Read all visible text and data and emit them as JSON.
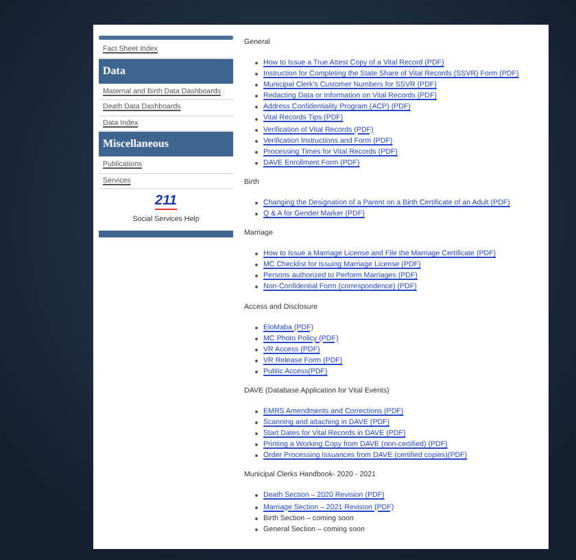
{
  "sidebar": {
    "items": [
      {
        "kind": "link",
        "text": "Fact Sheet Index"
      },
      {
        "kind": "header",
        "text": "Data"
      },
      {
        "kind": "link",
        "text": "Maternal and Birth Data Dashboards"
      },
      {
        "kind": "link",
        "text": "Death Data Dashboards"
      },
      {
        "kind": "link",
        "text": "Data Index"
      },
      {
        "kind": "header",
        "text": "Miscellaneous"
      },
      {
        "kind": "link",
        "text": "Publications"
      },
      {
        "kind": "link",
        "text": "Services"
      }
    ],
    "promo": {
      "logo": "211",
      "caption": "Social Services Help"
    }
  },
  "sections": [
    {
      "title": "General",
      "items": [
        {
          "kind": "link",
          "text": "How to Issue a True Attest Copy of a Vital Record (PDF)"
        },
        {
          "kind": "link",
          "text": "Instruction for Completing the State Share of Vital Records (SSVR) Form (PDF)"
        },
        {
          "kind": "link",
          "text": "Municipal Clerk's Customer Numbers for SSVR (PDF)"
        },
        {
          "kind": "link",
          "text": "Redacting Data or Information on Vital Records (PDF)"
        },
        {
          "kind": "link",
          "text": "Address Confidentiality Program (ACP) (PDF)"
        },
        {
          "kind": "link",
          "text": "Vital Records Tips (PDF)"
        },
        {
          "kind": "link",
          "text": "Verification of Vital Records (PDF)"
        },
        {
          "kind": "link",
          "text": "Verification Instructions and Form (PDF)"
        },
        {
          "kind": "link",
          "text": "Processing Times for Vital Records (PDF)"
        },
        {
          "kind": "link",
          "text": "DAVE Enrollment Form (PDF)"
        }
      ]
    },
    {
      "title": "Birth",
      "items": [
        {
          "kind": "link",
          "text": "Changing the Designation of a Parent on a Birth Certificate of an Adult (PDF)"
        },
        {
          "kind": "link",
          "text": "Q & A for Gender Marker (PDF)"
        }
      ]
    },
    {
      "title": "Marriage",
      "items": [
        {
          "kind": "link",
          "text": "How to Issue a Marriage License and File the Marriage Certificate (PDF)"
        },
        {
          "kind": "link",
          "text": "MC Checklist for Issuing Marriage License (PDF)"
        },
        {
          "kind": "link",
          "text": "Persons authorized to Perform Marriages (PDF)"
        },
        {
          "kind": "link",
          "text": "Non-Confidential Form (correspondence) (PDF)"
        }
      ]
    },
    {
      "title": "Access and Disclosure",
      "items": [
        {
          "kind": "link",
          "text": "EloMaba (PDF)"
        },
        {
          "kind": "link",
          "text": "MC Photo Policy (PDF)"
        },
        {
          "kind": "link",
          "text": "VR Access (PDF)"
        },
        {
          "kind": "link",
          "text": "VR Release Form (PDF)"
        },
        {
          "kind": "link",
          "text": "Public Access(PDF)"
        }
      ]
    },
    {
      "title": "DAVE (Database Application for Vital Events)",
      "items": [
        {
          "kind": "link",
          "text": "EMRS Amendments and Corrections (PDF)"
        },
        {
          "kind": "link",
          "text": "Scanning and attaching in DAVE (PDF)"
        },
        {
          "kind": "link",
          "text": "Start Dates for Vital Records in DAVE (PDF)"
        },
        {
          "kind": "link",
          "text": "Printing a Working Copy from DAVE (non-certified) (PDF)"
        },
        {
          "kind": "link",
          "text": "Order Processing Issuances from DAVE (certified copies)(PDF)"
        }
      ]
    },
    {
      "title": "Municipal Clerks Handbook- 2020 - 2021",
      "items": [
        {
          "kind": "link",
          "text": "Death Section – 2020 Revision (PDF)"
        },
        {
          "kind": "link",
          "text": "Marriage Section – 2021 Revision (PDF)"
        },
        {
          "kind": "text",
          "text": "Birth Section – coming soon"
        },
        {
          "kind": "text",
          "text": "General Section – coming soon"
        }
      ]
    }
  ]
}
